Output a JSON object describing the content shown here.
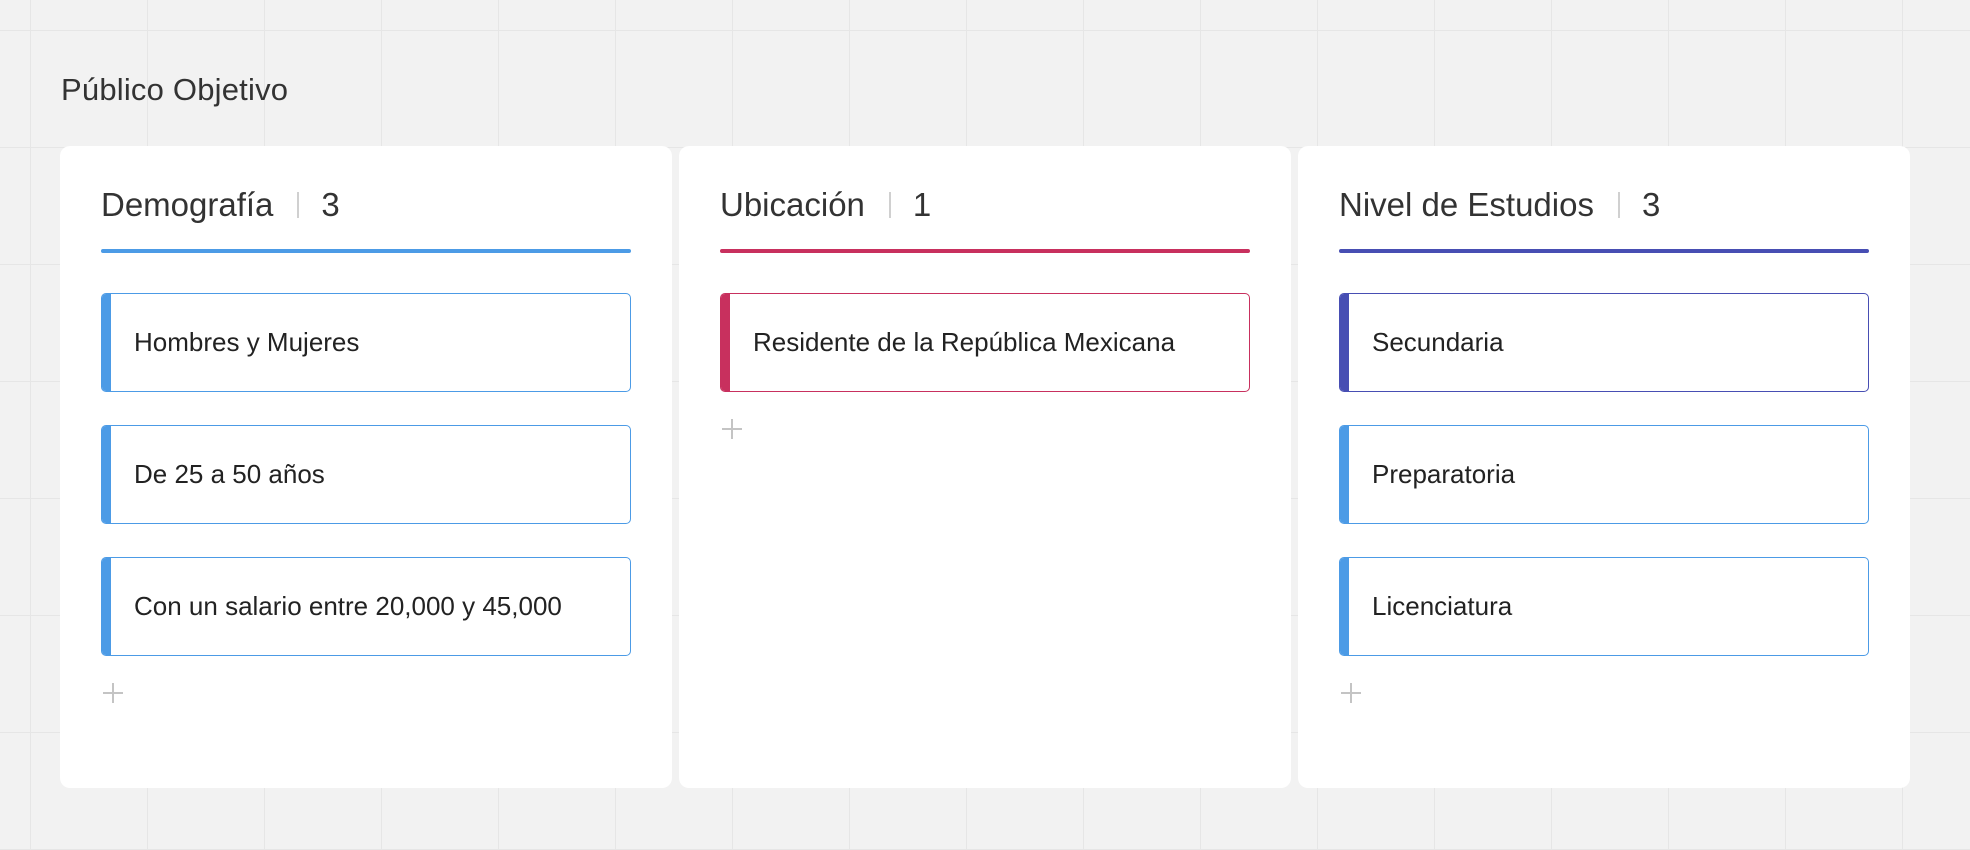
{
  "frame": {
    "title": "Público Objetivo"
  },
  "columns": [
    {
      "title": "Demografía",
      "count": "3",
      "color": "#4c9be6",
      "cards": [
        {
          "text": "Hombres y Mujeres",
          "color": "#4c9be6"
        },
        {
          "text": "De 25 a 50 años",
          "color": "#4c9be6"
        },
        {
          "text": "Con un salario entre 20,000 y 45,000",
          "color": "#4c9be6"
        }
      ],
      "add_icon": "plus-icon"
    },
    {
      "title": "Ubicación",
      "count": "1",
      "color": "#c8305e",
      "cards": [
        {
          "text": "Residente de la República Mexicana",
          "color": "#c8305e"
        }
      ],
      "add_icon": "plus-icon"
    },
    {
      "title": "Nivel de Estudios",
      "count": "3",
      "color": "#474eb3",
      "cards": [
        {
          "text": "Secundaria",
          "color": "#474eb3"
        },
        {
          "text": "Preparatoria",
          "color": "#4c9be6"
        },
        {
          "text": "Licenciatura",
          "color": "#4c9be6"
        }
      ],
      "add_icon": "plus-icon"
    }
  ]
}
